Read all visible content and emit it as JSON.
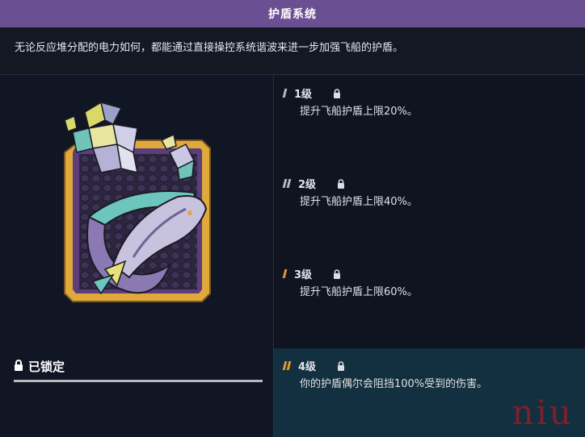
{
  "title": "护盾系统",
  "description": "无论反应堆分配的电力如何，都能通过直接操控系统谐波来进一步加强飞船的护盾。",
  "status": {
    "label": "已锁定",
    "icon": "lock-icon"
  },
  "levels": [
    {
      "label": "1级",
      "desc": "提升飞船护盾上限20%。",
      "pips": 1,
      "pip_color": "#b8b8c0",
      "locked": true
    },
    {
      "label": "2级",
      "desc": "提升飞船护盾上限40%。",
      "pips": 2,
      "pip_color": "#b8b8c0",
      "locked": true
    },
    {
      "label": "3级",
      "desc": "提升飞船护盾上限60%。",
      "pips": 1,
      "pip_color": "#e7962a",
      "locked": true
    },
    {
      "label": "4级",
      "desc": "你的护盾偶尔会阻挡100%受到的伤害。",
      "pips": 2,
      "pip_color": "#e7962a",
      "locked": true,
      "highlighted": true
    }
  ],
  "watermark": "niu",
  "colors": {
    "title_bar": "#6a4f92",
    "background": "#0f1420",
    "highlight": "#12303f",
    "accent_orange": "#e7962a",
    "badge_gold": "#e1a93b"
  }
}
